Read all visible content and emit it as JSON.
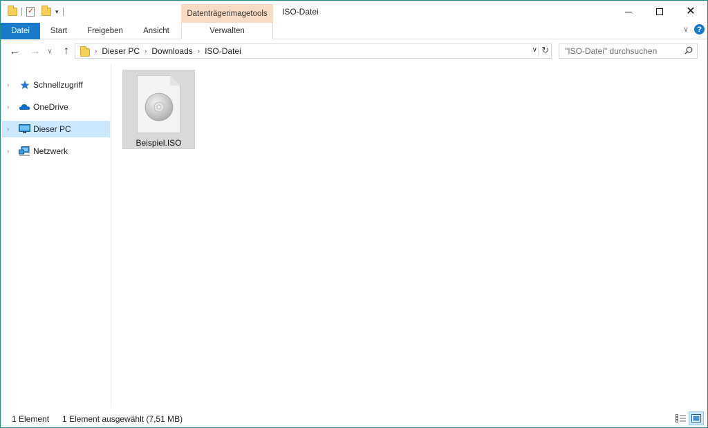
{
  "window": {
    "title": "ISO-Datei",
    "context_tab_group": "Datenträgerimagetools"
  },
  "ribbon": {
    "tabs": [
      {
        "label": "Datei"
      },
      {
        "label": "Start"
      },
      {
        "label": "Freigeben"
      },
      {
        "label": "Ansicht"
      },
      {
        "label": "Verwalten"
      }
    ]
  },
  "address": {
    "crumbs": [
      "Dieser PC",
      "Downloads",
      "ISO-Datei"
    ]
  },
  "search": {
    "placeholder": "\"ISO-Datei\" durchsuchen"
  },
  "navpane": {
    "items": [
      {
        "label": "Schnellzugriff",
        "icon": "star-icon"
      },
      {
        "label": "OneDrive",
        "icon": "cloud-icon"
      },
      {
        "label": "Dieser PC",
        "icon": "computer-icon",
        "selected": true
      },
      {
        "label": "Netzwerk",
        "icon": "network-icon"
      }
    ]
  },
  "files": [
    {
      "name": "Beispiel.ISO",
      "icon": "disc-image-icon",
      "selected": true
    }
  ],
  "status": {
    "count": "1 Element",
    "selection": "1 Element ausgewählt (7,51 MB)"
  },
  "colors": {
    "accent": "#1979ca",
    "context_tab": "#f7dbc5",
    "selection": "#cce8ff",
    "window_border": "#1b8f82"
  }
}
